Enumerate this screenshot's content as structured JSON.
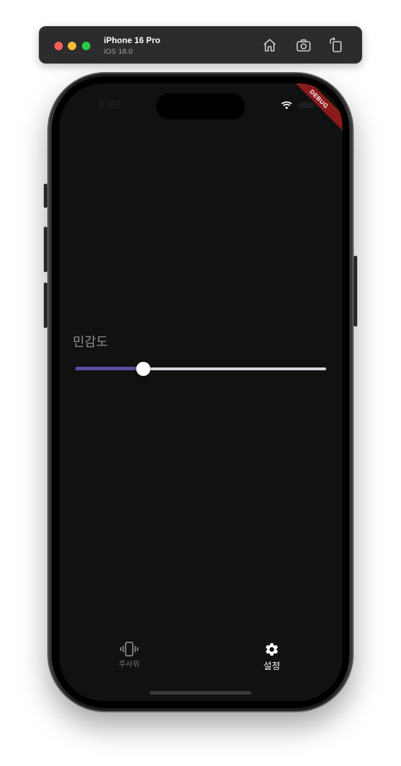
{
  "simulator": {
    "device_name": "iPhone 16 Pro",
    "os_version": "iOS 18.0"
  },
  "status_bar": {
    "time": "3:02"
  },
  "debug_banner": "DEBUG",
  "settings": {
    "sensitivity_label": "민감도",
    "sensitivity_value": 0.27,
    "slider_active_color": "#5b4ea3"
  },
  "bottom_nav": {
    "items": [
      {
        "label": "주사위",
        "icon": "phone-vibrate-icon",
        "selected": false
      },
      {
        "label": "설정",
        "icon": "gear-icon",
        "selected": true
      }
    ]
  }
}
